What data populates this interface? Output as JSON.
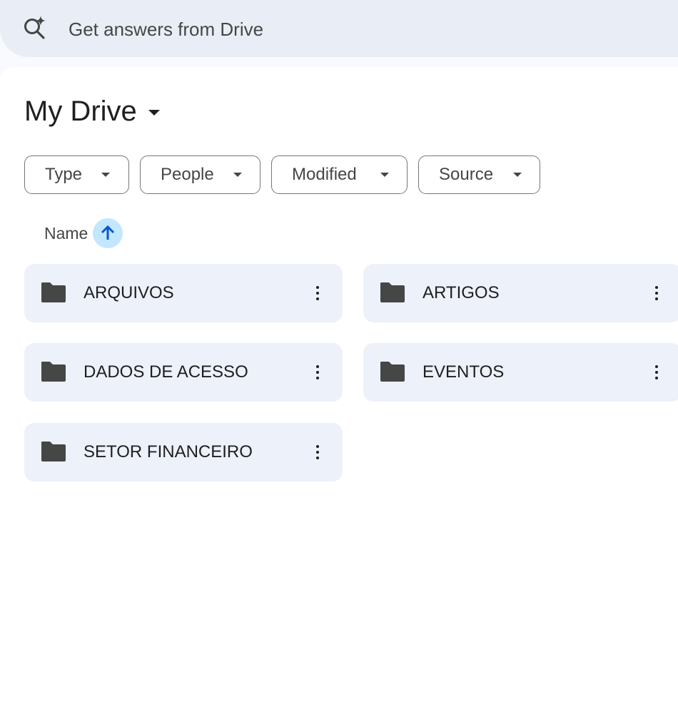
{
  "search": {
    "placeholder": "Get answers from Drive",
    "icon": "sparkle-search-icon"
  },
  "header": {
    "title": "My Drive"
  },
  "filters": [
    {
      "label": "Type"
    },
    {
      "label": "People"
    },
    {
      "label": "Modified"
    },
    {
      "label": "Source"
    }
  ],
  "sort": {
    "label": "Name",
    "direction_icon": "arrow-up-icon"
  },
  "folders": [
    {
      "name": "ARQUIVOS"
    },
    {
      "name": "ARTIGOS"
    },
    {
      "name": "DADOS DE ACESSO"
    },
    {
      "name": "EVENTOS"
    },
    {
      "name": "SETOR FINANCEIRO"
    }
  ],
  "colors": {
    "search_bg": "#e9eef6",
    "card_bg": "#edf1f9",
    "sort_accent": "#c2e7ff",
    "sort_arrow": "#0b57d0",
    "folder_icon": "#444746"
  }
}
